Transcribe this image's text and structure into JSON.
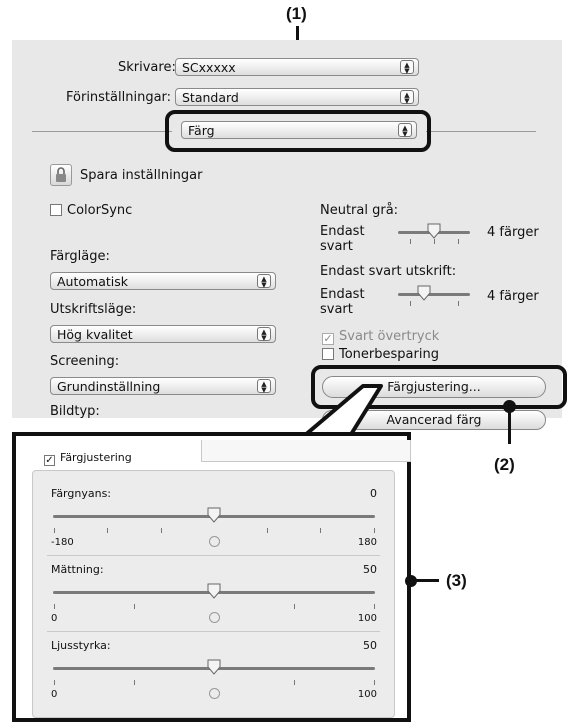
{
  "callouts": {
    "c1": "(1)",
    "c2": "(2)",
    "c3": "(3)"
  },
  "printer": {
    "label": "Skrivare:",
    "value": "SCxxxxx"
  },
  "presets": {
    "label": "Förinställningar:",
    "value": "Standard"
  },
  "panel_menu": {
    "value": "Färg"
  },
  "save_settings": {
    "label": "Spara inställningar"
  },
  "colorsync": {
    "label": "ColorSync",
    "checked": false
  },
  "color_mode": {
    "label": "Färgläge:",
    "value": "Automatisk"
  },
  "print_mode": {
    "label": "Utskriftsläge:",
    "value": "Hög kvalitet"
  },
  "screening": {
    "label": "Screening:",
    "value": "Grundinställning"
  },
  "image_type": {
    "label": "Bildtyp:"
  },
  "neutral_gray": {
    "label": "Neutral grå:",
    "left": "Endast svart",
    "right": "4 färger"
  },
  "black_only_print": {
    "label": "Endast svart utskrift:",
    "left": "Endast svart",
    "right": "4 färger"
  },
  "black_overprint": {
    "label": "Svart övertryck",
    "checked": true
  },
  "toner_saving": {
    "label": "Tonerbesparing",
    "checked": false
  },
  "color_adjust_button": {
    "label": "Färgjustering..."
  },
  "advanced_color_button": {
    "label": "Avancerad färg"
  },
  "color_adjustment_panel": {
    "checkbox_label": "Färgjustering",
    "checked": true,
    "sliders": [
      {
        "label": "Färgnyans:",
        "value": "0",
        "min": "-180",
        "max": "180",
        "fraction": 0.5
      },
      {
        "label": "Mättning:",
        "value": "50",
        "min": "0",
        "max": "100",
        "fraction": 0.5
      },
      {
        "label": "Ljusstyrka:",
        "value": "50",
        "min": "0",
        "max": "100",
        "fraction": 0.5
      }
    ]
  }
}
